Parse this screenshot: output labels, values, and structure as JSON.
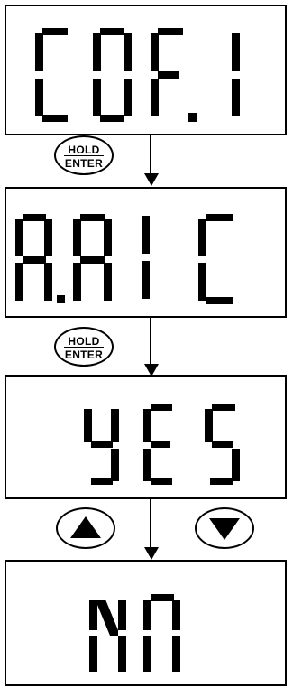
{
  "screens": [
    {
      "id": "screen-1",
      "text": "COF.1"
    },
    {
      "id": "screen-2",
      "text": "A.ATC"
    },
    {
      "id": "screen-3",
      "text": "YES"
    },
    {
      "id": "screen-4",
      "text": "NO"
    }
  ],
  "buttons": {
    "hold_enter": {
      "line1": "HOLD",
      "line2": "ENTER"
    },
    "up": {
      "icon": "triangle-up-icon"
    },
    "down": {
      "icon": "triangle-down-icon"
    }
  }
}
